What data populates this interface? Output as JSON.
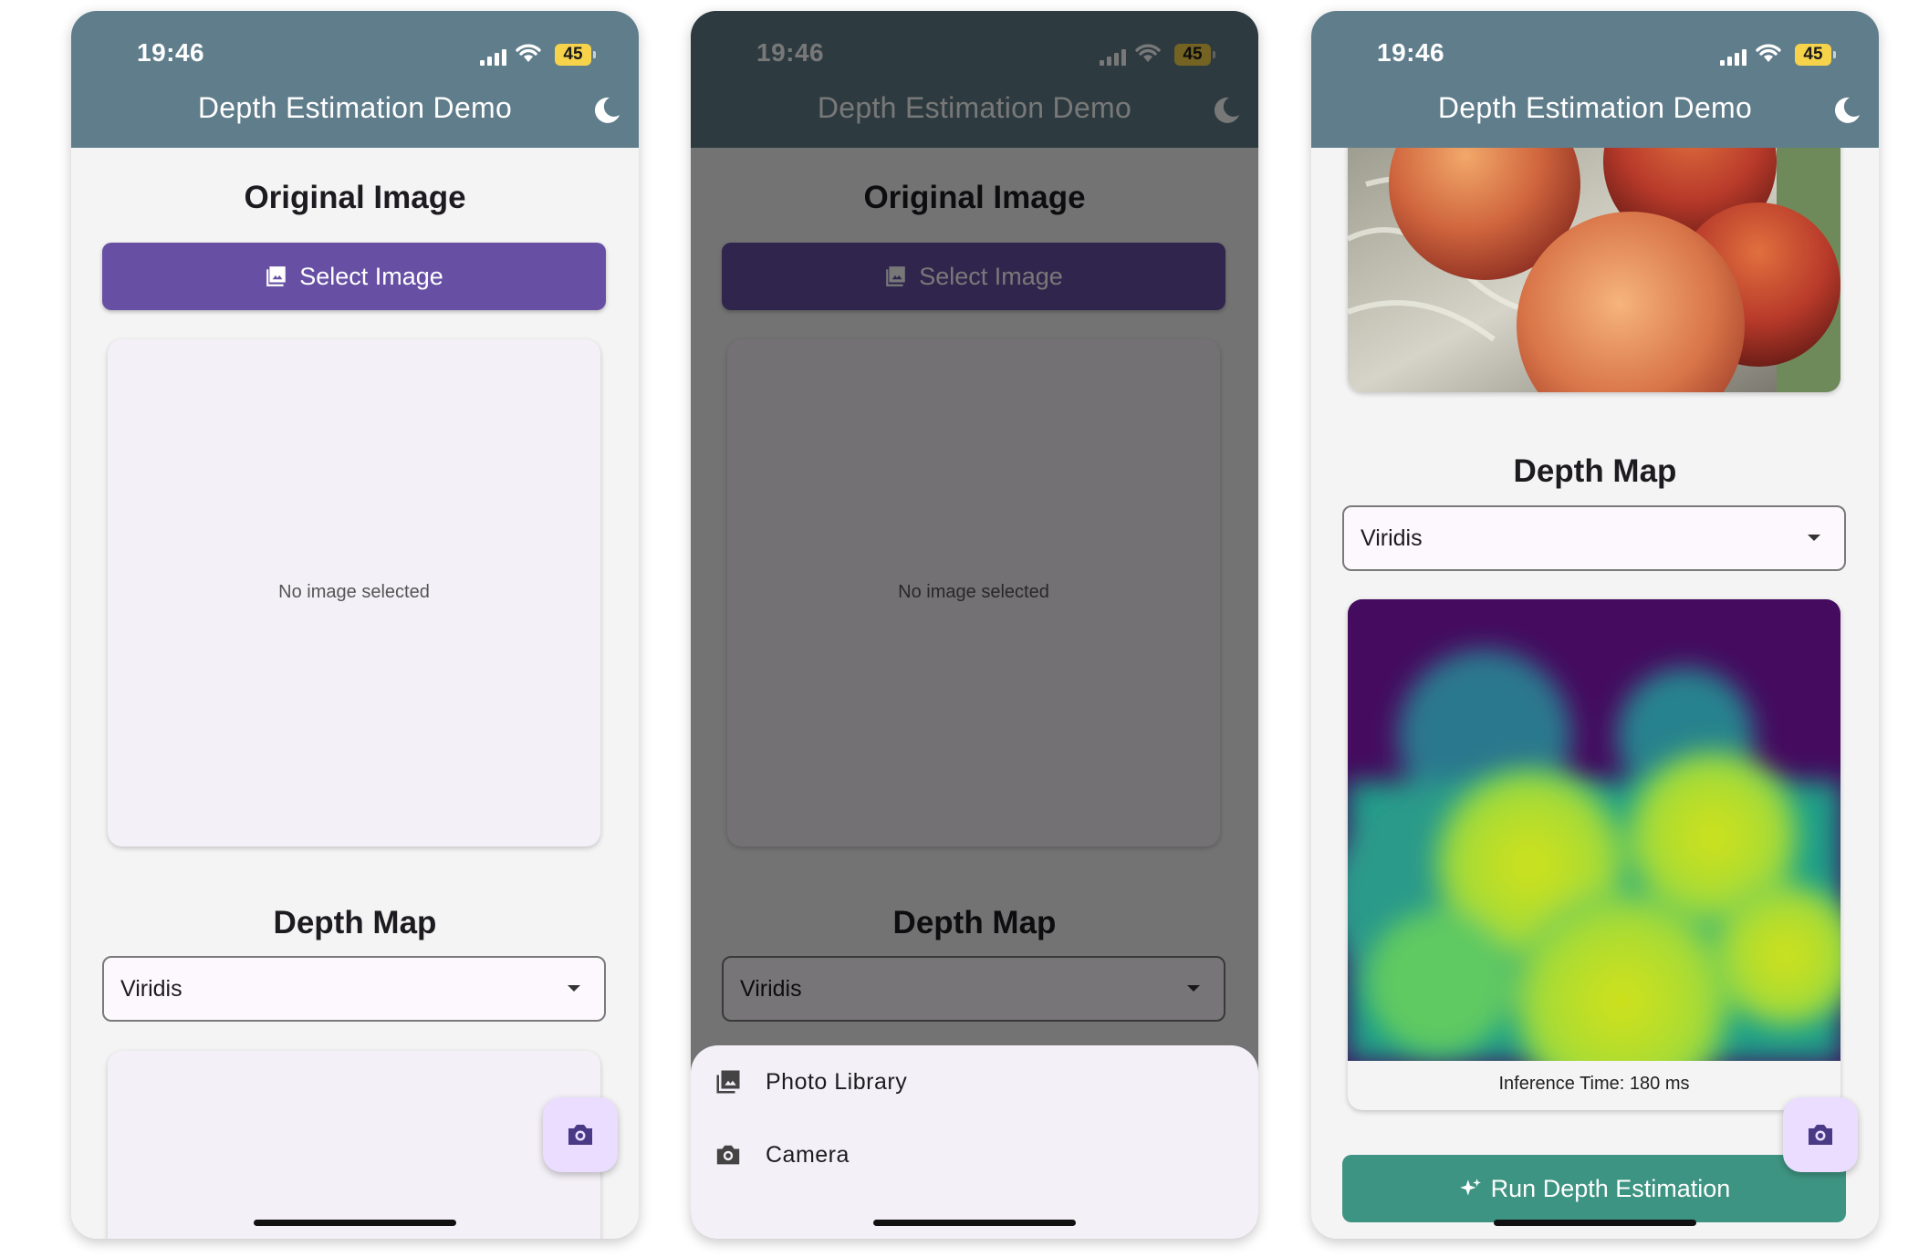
{
  "status_bar": {
    "time": "19:46",
    "battery": "45"
  },
  "app_bar": {
    "title": "Depth Estimation Demo",
    "theme_toggle_icon": "moon-icon"
  },
  "original_section": {
    "title": "Original Image",
    "select_button_label": "Select Image",
    "select_button_icon": "image-icon",
    "placeholder": "No image selected"
  },
  "depth_section": {
    "title": "Depth Map",
    "colormap_selected": "Viridis",
    "inference_time": "Inference Time: 180 ms"
  },
  "fab": {
    "icon": "camera-icon"
  },
  "image_source_sheet": {
    "items": [
      {
        "label": "Photo Library",
        "icon": "photo-library-icon"
      },
      {
        "label": "Camera",
        "icon": "camera-icon"
      }
    ]
  },
  "run_button": {
    "label": "Run Depth Estimation",
    "icon": "sparkle-icon"
  },
  "colors": {
    "app_bar": "#607d8b",
    "primary": "#6750a4",
    "run_button": "#3e9482",
    "fab": "#eaddff",
    "surface": "#f4f0f7"
  }
}
